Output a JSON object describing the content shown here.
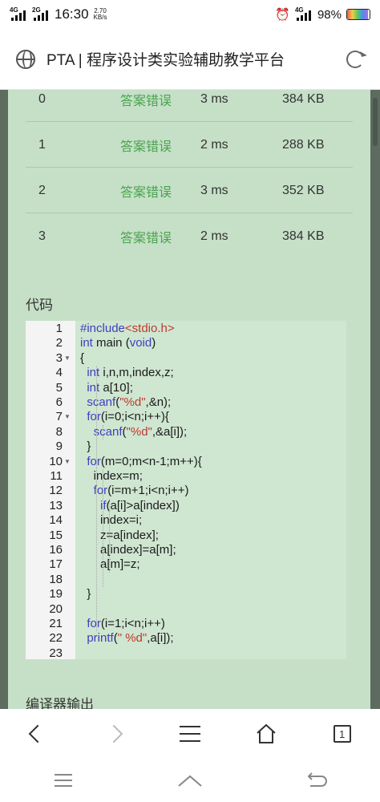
{
  "status_bar": {
    "net1": "4G",
    "net2": "2G",
    "time": "16:30",
    "speed_value": "2.70",
    "speed_unit": "KB/s",
    "net3": "4G",
    "battery": "98%"
  },
  "address_bar": {
    "title": "PTA | 程序设计类实验辅助教学平台"
  },
  "results": [
    {
      "index": "0",
      "result": "答案错误",
      "time": "3 ms",
      "memory": "384 KB"
    },
    {
      "index": "1",
      "result": "答案错误",
      "time": "2 ms",
      "memory": "288 KB"
    },
    {
      "index": "2",
      "result": "答案错误",
      "time": "3 ms",
      "memory": "352 KB"
    },
    {
      "index": "3",
      "result": "答案错误",
      "time": "2 ms",
      "memory": "384 KB"
    }
  ],
  "code_section": {
    "label": "代码",
    "lines": [
      "#include<stdio.h>",
      "int main (void)",
      "{",
      "  int i,n,m,index,z;",
      "  int a[10];",
      "  scanf(\"%d\",&n);",
      "  for(i=0;i<n;i++){",
      "    scanf(\"%d\",&a[i]);",
      "  }",
      "  for(m=0;m<n-1;m++){",
      "    index=m;",
      "    for(i=m+1;i<n;i++)",
      "      if(a[i]>a[index])",
      "      index=i;",
      "      z=a[index];",
      "      a[index]=a[m];",
      "      a[m]=z;",
      "",
      "  }",
      "",
      "  for(i=1;i<n;i++)",
      "  printf(\" %d\",a[i]);",
      ""
    ]
  },
  "compiler_output": {
    "label": "编译器输出"
  },
  "browser_nav": {
    "tab_count": "1"
  }
}
